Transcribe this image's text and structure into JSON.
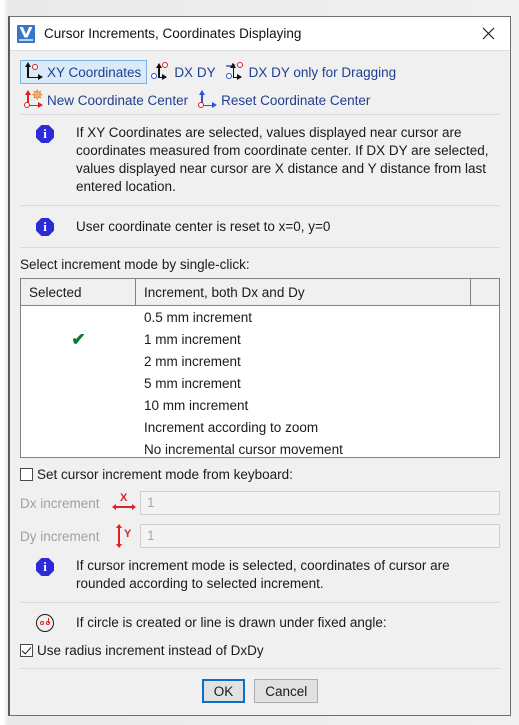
{
  "window": {
    "title": "Cursor Increments, Coordinates Displaying",
    "app_icon": "varicad-logo-icon",
    "close_icon": "close-icon"
  },
  "toolbar": {
    "row1": [
      {
        "label": "XY Coordinates",
        "icon": "xy-axes-icon",
        "active": true
      },
      {
        "label": "DX DY",
        "icon": "dx-dy-axes-icon",
        "active": false
      },
      {
        "label": "DX DY only for Dragging",
        "icon": "dx-dy-dragging-icon",
        "active": false
      }
    ],
    "row2": [
      {
        "label": "New Coordinate Center",
        "icon": "new-coordinate-center-icon",
        "active": false
      },
      {
        "label": "Reset Coordinate Center",
        "icon": "reset-coordinate-center-icon",
        "active": false
      }
    ]
  },
  "info1": {
    "icon": "info-icon",
    "text": "If XY Coordinates are selected, values displayed near cursor are coordinates measured from coordinate center. If DX DY are selected, values displayed near cursor are X distance and Y distance from last entered location."
  },
  "info2": {
    "icon": "info-icon",
    "text": "User coordinate center is reset to x=0, y=0"
  },
  "increment_list": {
    "section_label": "Select increment mode by single-click:",
    "columns": [
      "Selected",
      "Increment, both Dx and Dy",
      ""
    ],
    "check_glyph": "✔",
    "rows": [
      {
        "selected": false,
        "label": "0.5 mm increment"
      },
      {
        "selected": true,
        "label": "1 mm increment"
      },
      {
        "selected": false,
        "label": "2 mm increment"
      },
      {
        "selected": false,
        "label": "5 mm increment"
      },
      {
        "selected": false,
        "label": "10 mm increment"
      },
      {
        "selected": false,
        "label": "Increment according to zoom"
      },
      {
        "selected": false,
        "label": "No incremental cursor movement"
      }
    ]
  },
  "keyboard": {
    "checkbox_label": "Set cursor increment mode from keyboard:",
    "checkbox_checked": false,
    "dx": {
      "label": "Dx increment",
      "icon": "dx-arrow-icon",
      "value": "1",
      "letter": "X",
      "disabled": true
    },
    "dy": {
      "label": "Dy increment",
      "icon": "dy-arrow-icon",
      "value": "1",
      "letter": "Y",
      "disabled": true
    }
  },
  "info3": {
    "icon": "info-icon",
    "text": "If cursor increment mode is selected, coordinates of cursor are rounded according to selected increment."
  },
  "circle_section": {
    "icon": "circle-radius-icon",
    "text": "If circle is created or line is drawn under fixed angle:",
    "checkbox_label": "Use radius increment instead of DxDy",
    "checkbox_checked": true
  },
  "footer": {
    "ok_label": "OK",
    "cancel_label": "Cancel"
  },
  "colors": {
    "accent_blue": "#0d6fc4",
    "link_blue": "#1f3f8f",
    "selected_bg": "#d9ebf9",
    "info_blue": "#2b2bd8",
    "check_green": "#0b7a27",
    "axis_red": "#e02020"
  }
}
